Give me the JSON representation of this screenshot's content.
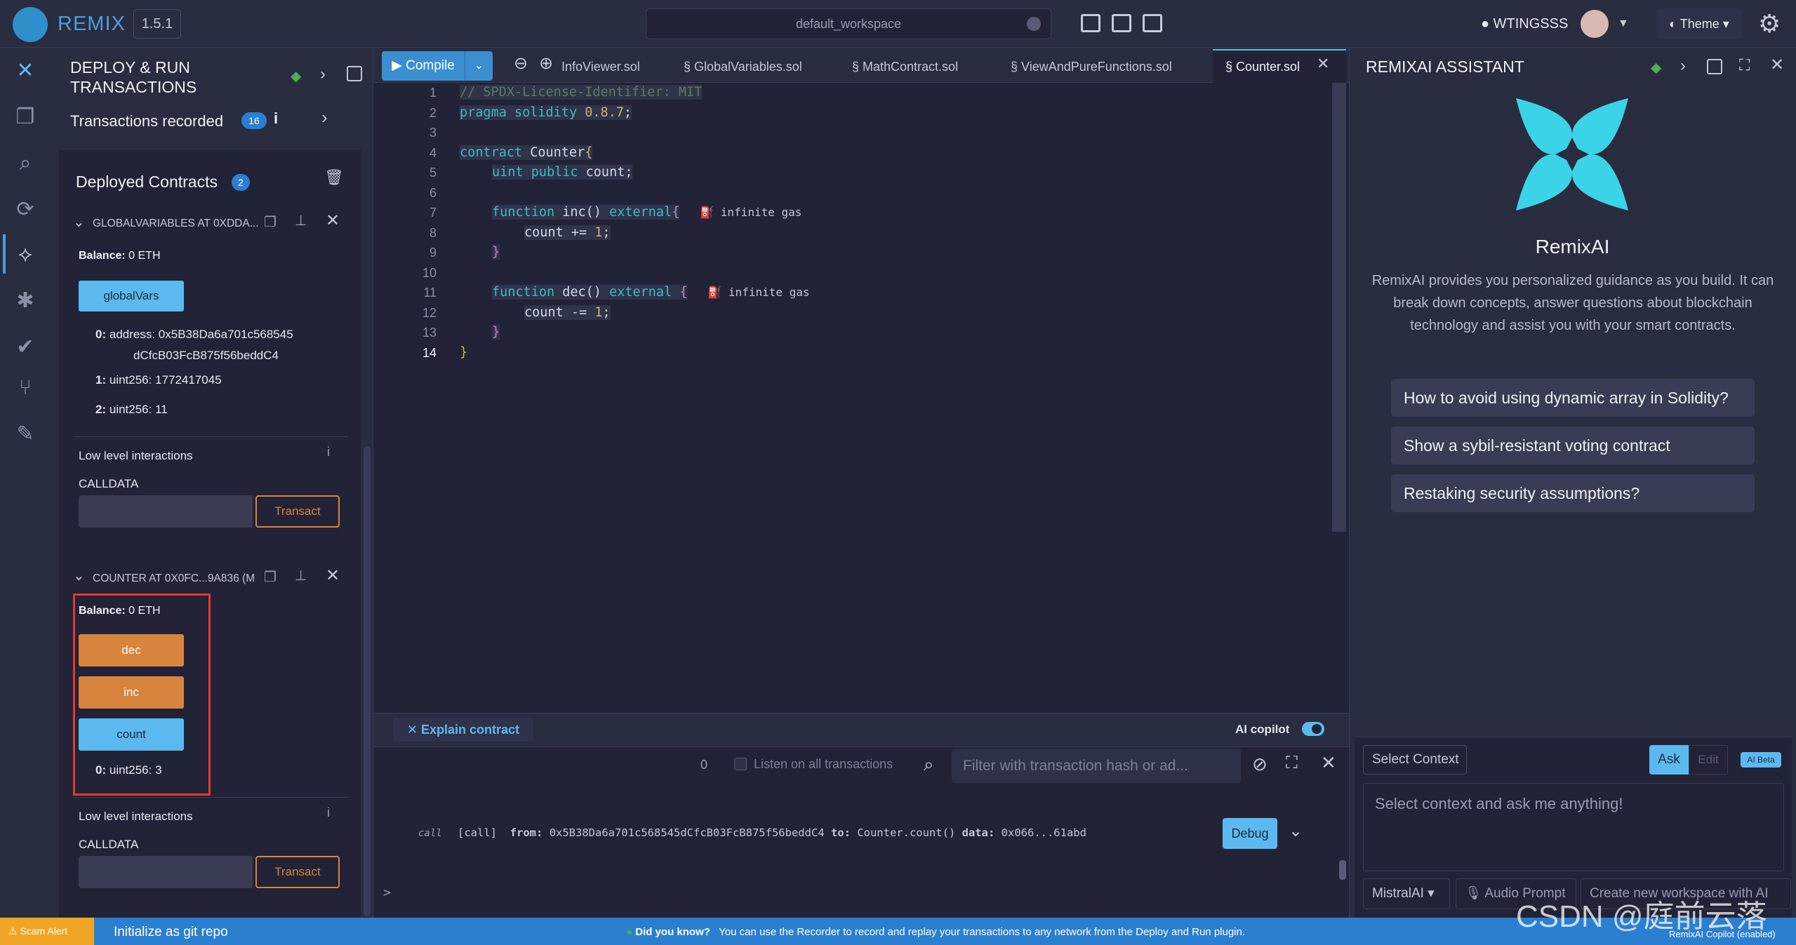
{
  "app": {
    "name": "REMIX",
    "version": "1.5.1",
    "workspace": "default_workspace"
  },
  "header": {
    "user": "WTINGSSS",
    "theme_label": "Theme"
  },
  "deploy": {
    "title_line1": "DEPLOY & RUN",
    "title_line2": "TRANSACTIONS",
    "transactions_recorded": "Transactions recorded",
    "tx_count": "16",
    "deployed_contracts": "Deployed Contracts",
    "deployed_count": "2",
    "contracts": [
      {
        "name": "GLOBALVARIABLES AT 0XDDA...",
        "balance_label": "Balance:",
        "balance_value": "0 ETH",
        "button": "globalVars",
        "results": [
          {
            "key": "0:",
            "line1": "address: 0x5B38Da6a701c568545",
            "line2": "dCfcB03FcB875f56beddC4"
          },
          {
            "key": "1:",
            "line1": "uint256: 1772417045"
          },
          {
            "key": "2:",
            "line1": "uint256: 11"
          }
        ],
        "low_level": "Low level interactions",
        "calldata": "CALLDATA",
        "transact": "Transact"
      },
      {
        "name": "COUNTER AT 0X0FC...9A836 (M",
        "balance_label": "Balance:",
        "balance_value": "0 ETH",
        "buttons": [
          "dec",
          "inc",
          "count"
        ],
        "result_key": "0:",
        "result_value": "uint256: 3",
        "low_level": "Low level interactions",
        "calldata": "CALLDATA",
        "transact": "Transact"
      }
    ]
  },
  "editor": {
    "compile": "Compile",
    "tabs": [
      "InfoViewer.sol",
      "GlobalVariables.sol",
      "MathContract.sol",
      "ViewAndPureFunctions.sol",
      "Counter.sol"
    ],
    "gas_label": "infinite gas",
    "lines": [
      "1",
      "2",
      "3",
      "4",
      "5",
      "6",
      "7",
      "8",
      "9",
      "10",
      "11",
      "12",
      "13",
      "14"
    ],
    "code": {
      "l1": "// SPDX-License-Identifier: MIT",
      "l2a": "pragma solidity ",
      "l2b": "0.8.7",
      "l2c": ";",
      "l4a": "contract ",
      "l4b": "Counter",
      "l4c": "{",
      "l5a": "uint public ",
      "l5b": "count;",
      "l7a": "function ",
      "l7b": "inc() ",
      "l7c": "external",
      "l7d": "{",
      "l8a": "count += ",
      "l8b": "1",
      "l8c": ";",
      "l9": "}",
      "l11a": "function ",
      "l11b": "dec() ",
      "l11c": "external ",
      "l11d": "{",
      "l12a": "count -= ",
      "l12b": "1",
      "l12c": ";",
      "l13": "}",
      "l14": "}"
    }
  },
  "aibar": {
    "explain": "Explain contract",
    "copilot": "AI copilot"
  },
  "terminal": {
    "count": "0",
    "listen": "Listen on all transactions",
    "filter_placeholder": "Filter with transaction hash or ad...",
    "log_call": "[call]",
    "log_from_label": "from:",
    "log_from": "0x5B38Da6a701c568545dCfcB03FcB875f56beddC4",
    "log_to_label": "to:",
    "log_to": "Counter.count()",
    "log_data_label": "data:",
    "log_data": "0x066...61abd",
    "debug": "Debug",
    "prompt": ">"
  },
  "ai": {
    "title": "REMIXAI ASSISTANT",
    "name": "RemixAI",
    "description": "RemixAI provides you personalized guidance as you build. It can break down concepts, answer questions about blockchain technology and assist you with your smart contracts.",
    "suggestions": [
      "How to avoid using dynamic array in Solidity?",
      "Show a sybil-resistant voting contract",
      "Restaking security assumptions?"
    ],
    "select_context": "Select Context",
    "ask": "Ask",
    "edit": "Edit",
    "beta": "AI Beta",
    "input_placeholder": "Select context and ask me anything!",
    "model": "MistralAI",
    "audio": "Audio Prompt",
    "create": "Create new workspace with AI",
    "copilot_status": "RemixAI Copilot (enabled)"
  },
  "status": {
    "scam": "Scam Alert",
    "git": "Initialize as git repo",
    "did_you_know": "Did you know?",
    "tip": "You can use the Recorder to record and replay your transactions to any network from the Deploy and Run plugin."
  },
  "watermark": "CSDN @庭前云落",
  "colors": {
    "accent": "#5bb9f0",
    "orange": "#d9843c",
    "highlight": "#e53935",
    "status": "#2b7fd0"
  }
}
